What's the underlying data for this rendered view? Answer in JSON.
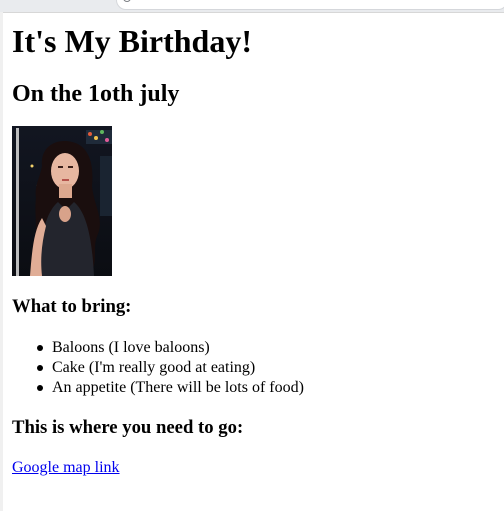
{
  "page": {
    "title": "It's My Birthday!",
    "subtitle": "On the 1oth july",
    "photo_alt": "birthday girl photo",
    "bring_heading": "What to bring:",
    "bring_items": [
      "Baloons (I love baloons)",
      "Cake (I'm really good at eating)",
      "An appetite (There will be lots of food)"
    ],
    "location_heading": "This is where you need to go:",
    "map_link": "Google map link"
  },
  "colors": {
    "link": "#0000ee",
    "text": "#000000",
    "background": "#ffffff"
  }
}
